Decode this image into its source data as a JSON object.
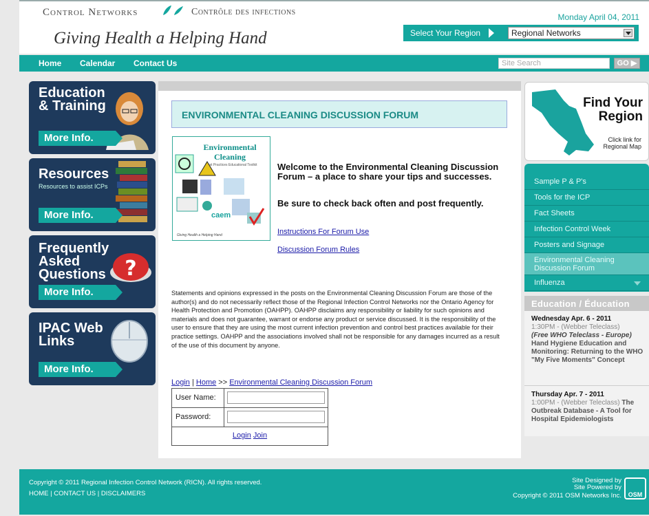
{
  "header": {
    "brand_en": "Control Networks",
    "brand_fr": "Contrôle des infections",
    "tagline": "Giving Health a Helping Hand",
    "date": "Monday April 04, 2011",
    "region_label": "Select Your Region",
    "region_value": "Regional Networks"
  },
  "nav": {
    "items": [
      "Home",
      "Calendar",
      "Contact Us"
    ],
    "search_placeholder": "Site Search",
    "go_label": "GO"
  },
  "promos": [
    {
      "title": "Education & Training",
      "more": "More Info."
    },
    {
      "title": "Resources",
      "subtitle": "Resources to assist ICPs",
      "more": "More Info."
    },
    {
      "title": "Frequently Asked Questions",
      "more": "More Info."
    },
    {
      "title": "IPAC Web Links",
      "more": "More Info."
    }
  ],
  "main": {
    "forum_title": "ENVIRONMENTAL CLEANING DISCUSSION FORUM",
    "cover": {
      "title": "Environmental Cleaning",
      "subtitle": "Best Practices Educational Toolkit",
      "org": "caem",
      "footer": "Giving Health a Helping Hand"
    },
    "welcome": "Welcome to the Environmental Cleaning Discussion Forum – a place to share your tips and successes.",
    "check_back": "Be sure to check back often and post frequently.",
    "link_instructions": "Instructions For Forum Use",
    "link_rules": "Discussion Forum Rules",
    "disclaimer": "Statements and opinions expressed in the posts on the Environmental Cleaning Discussion Forum are those of the author(s) and do not necessarily reflect those of the Regional Infection Control Networks nor the Ontario Agency for Health Protection and Promotion (OAHPP). OAHPP disclaims any responsibility or liability for such opinions and materials and does not guarantee, warrant or endorse any product or service discussed. It is the responsibility of the user to ensure that they are using the most current infection prevention and control best practices available for their practice settings. OAHPP and the associations involved shall not be responsible for any damages incurred as a result of the use of this document by anyone.",
    "breadcrumb": {
      "login": "Login",
      "sep1": " | ",
      "home": "Home",
      "sep2": " >> ",
      "forum": "Environmental Cleaning Discussion Forum"
    },
    "login": {
      "username_label": "User Name:",
      "password_label": "Password:",
      "login_link": "Login",
      "join_link": "Join"
    }
  },
  "right": {
    "find_region_title": "Find Your Region",
    "find_region_sub": "Click link for Regional Map",
    "menu": [
      "Sample P & P's",
      "Tools for the ICP",
      "Fact Sheets",
      "Infection Control Week",
      "Posters and Signage",
      "Environmental Cleaning Discussion Forum",
      "Influenza"
    ],
    "education_header": "Education / Éducation",
    "events": [
      {
        "date": "Wednesday Apr. 6 - 2011",
        "time": "1:30PM - (Webber Teleclass)",
        "tag": "(Free WHO Teleclass - Europe)",
        "desc": "Hand Hygiene Education and Monitoring: Returning to the WHO \"My Five Moments\" Concept"
      },
      {
        "date": "Thursday Apr. 7 - 2011",
        "time": "1:00PM - (Webber Teleclass)",
        "desc": "The Outbreak Database - A Tool for Hospital Epidemiologists"
      }
    ]
  },
  "footer": {
    "copyright": "Copyright © 2011 Regional Infection Control Network (RICN). All rights reserved.",
    "links": [
      "HOME",
      "CONTACT US",
      "DISCLAIMERS"
    ],
    "link_sep": " | ",
    "designed_by": "Site Designed by",
    "powered_by": "Site Powered by",
    "osm_copyright": "Copyright © 2011 OSM Networks Inc.",
    "osm_logo": "OSM"
  },
  "colors": {
    "teal": "#14a79f",
    "navy": "#1e3a5c",
    "link": "#1a1aa8"
  }
}
